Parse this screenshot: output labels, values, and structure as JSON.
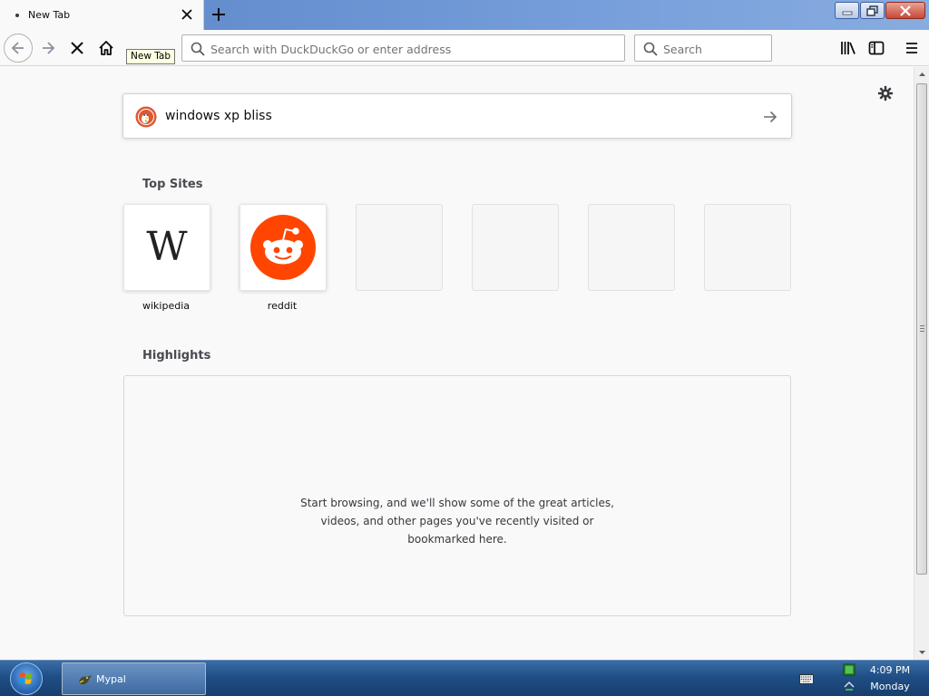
{
  "window": {
    "tab_title": "New Tab",
    "minimize_icon": "minimize-icon",
    "restore_icon": "restore-icon",
    "close_icon": "close-icon"
  },
  "toolbar": {
    "url_placeholder": "Search with DuckDuckGo or enter address",
    "search_placeholder": "Search",
    "tooltip": "New Tab",
    "icons": [
      "back-icon",
      "forward-icon",
      "stop-icon",
      "home-icon",
      "library-icon",
      "sidebar-icon",
      "menu-icon"
    ]
  },
  "page": {
    "search_query": "windows xp bliss",
    "top_sites_title": "Top Sites",
    "top_sites": [
      {
        "label": "wikipedia",
        "icon": "wikipedia-logo"
      },
      {
        "label": "reddit",
        "icon": "reddit-logo"
      },
      {
        "label": "",
        "icon": ""
      },
      {
        "label": "",
        "icon": ""
      },
      {
        "label": "",
        "icon": ""
      },
      {
        "label": "",
        "icon": ""
      }
    ],
    "wiki_letter": "W",
    "highlights_title": "Highlights",
    "highlights_message": "Start browsing, and we'll show some of the great articles, videos, and other pages you've recently visited or bookmarked here.",
    "highlights_lines": [
      "Start browsing, and we'll show some of the great articles,",
      "videos, and other pages you've recently visited or",
      "bookmarked here."
    ]
  },
  "taskbar": {
    "task_label": "Mypal",
    "clock_time": "4:09 PM",
    "clock_day": "Monday"
  },
  "colors": {
    "reddit": "#ff4500",
    "duckduckgo": "#de5833",
    "taskbar": "#1f4f86"
  }
}
